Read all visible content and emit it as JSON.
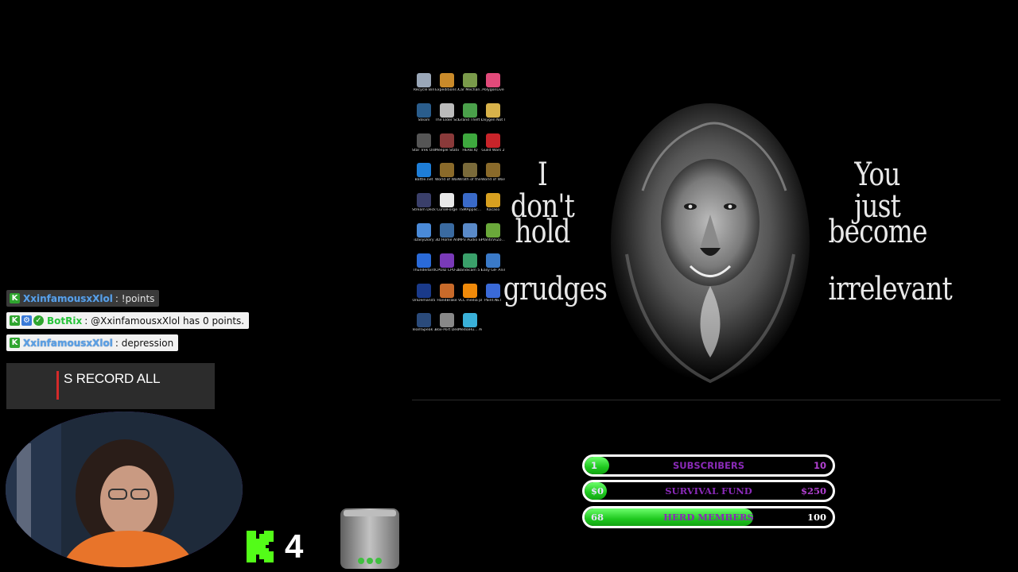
{
  "desktop": {
    "icons": [
      {
        "label": "Recycle Bin",
        "icon": "recycle-bin-icon",
        "color": "#9aa7b8"
      },
      {
        "label": "Expeditions A MudRunner ...",
        "icon": "expeditions-icon",
        "color": "#c98a2a"
      },
      {
        "label": "Car Mechan...",
        "icon": "car-mechanic-icon",
        "color": "#7a9a4a"
      },
      {
        "label": "PolygonLive",
        "icon": "polygonlive-icon",
        "color": "#e24a7a"
      },
      {
        "label": "Steam",
        "icon": "steam-icon",
        "color": "#2a5d8c"
      },
      {
        "label": "The Elder Scrolls ...",
        "icon": "elder-scrolls-icon",
        "color": "#bbbbbb"
      },
      {
        "label": "Grand Theft Auto V",
        "icon": "gta-icon",
        "color": "#4aa04a"
      },
      {
        "label": "Oxygen Not Included",
        "icon": "oxygen-icon",
        "color": "#d8b24a"
      },
      {
        "label": "Star Trek Online",
        "icon": "star-trek-icon",
        "color": "#555555"
      },
      {
        "label": "Meeple Station",
        "icon": "meeple-icon",
        "color": "#8a3a3a"
      },
      {
        "label": "HERB.IQ",
        "icon": "herb-icon",
        "color": "#3ea83e"
      },
      {
        "label": "Guild Wars 2",
        "icon": "guild-wars-icon",
        "color": "#c8242a"
      },
      {
        "label": "Battle.net",
        "icon": "battlenet-icon",
        "color": "#1e7ed8"
      },
      {
        "label": "World of Warcra...",
        "icon": "wow-icon",
        "color": "#8a6a2a"
      },
      {
        "label": "Wrath of the Lich King ...",
        "icon": "wotlk-icon",
        "color": "#7a6a3a"
      },
      {
        "label": "World of Warcraft",
        "icon": "wow-classic-icon",
        "color": "#8a6a2a"
      },
      {
        "label": "Stream Deck",
        "icon": "stream-deck-icon",
        "color": "#3a3f6a"
      },
      {
        "label": "CurseForge",
        "icon": "curseforge-icon",
        "color": "#e8e8e8"
      },
      {
        "label": "TSMApplic...",
        "icon": "tsm-icon",
        "color": "#3a6ac8"
      },
      {
        "label": "Kacaso",
        "icon": "kacaso-icon",
        "color": "#d8a020"
      },
      {
        "label": "iDailyDiary",
        "icon": "diary-icon",
        "color": "#4a8ad8"
      },
      {
        "label": "3D Home Architect ...",
        "icon": "home-architect-icon",
        "color": "#3a6aa0"
      },
      {
        "label": "MP3 Audio Editor",
        "icon": "mp3-editor-icon",
        "color": "#5a8ac8"
      },
      {
        "label": "PlantsVsZo...",
        "icon": "pvz-icon",
        "color": "#6aa83a"
      },
      {
        "label": "Thunderbird",
        "icon": "thunderbird-icon",
        "color": "#2a6ad8"
      },
      {
        "label": "CPUID CPU-Z",
        "icon": "cpuz-icon",
        "color": "#7a3ab8"
      },
      {
        "label": "Bandicam 5 Pro",
        "icon": "bandicam-icon",
        "color": "#3aa06a"
      },
      {
        "label": "Easy GIF Animator",
        "icon": "gif-animator-icon",
        "color": "#3a7ac8"
      },
      {
        "label": "OnDemand5",
        "icon": "ondemand-icon",
        "color": "#1a3a8a"
      },
      {
        "label": "HandBrake",
        "icon": "handbrake-icon",
        "color": "#c86a2a"
      },
      {
        "label": "VLC media player",
        "icon": "vlc-icon",
        "color": "#f08a0a"
      },
      {
        "label": "Paint.NET",
        "icon": "paintnet-icon",
        "color": "#3a6ad8"
      },
      {
        "label": "TeamSpeak 3 Client",
        "icon": "teamspeak-icon",
        "color": "#2a4a7a"
      },
      {
        "label": "Box-Port Design",
        "icon": "boxport-icon",
        "color": "#888888"
      },
      {
        "label": "MediaHu... Audio Con...",
        "icon": "mediahuman-icon",
        "color": "#3ab0d8"
      }
    ],
    "quote_left": [
      "I don't",
      "hold",
      "grudges"
    ],
    "quote_right": [
      "You just",
      "become",
      "irrelevant"
    ]
  },
  "chat": [
    {
      "user": "XxinfamousxXlol",
      "message": ": !points",
      "badges": [
        "kick-badge-icon"
      ],
      "dim": true
    },
    {
      "user": "BotRix",
      "message": ": @XxinfamousxXlol has 0 points.",
      "badges": [
        "kick-badge-icon",
        "bot-badge-icon",
        "verified-badge-icon"
      ],
      "dim": false
    },
    {
      "user": "XxinfamousxXlol",
      "message": ": depression",
      "badges": [
        "kick-badge-icon"
      ],
      "dim": false
    }
  ],
  "alert": {
    "text": "S RECORD ALL",
    "accent": "#d42a2a"
  },
  "kick_counter": {
    "value": "4",
    "icon": "kick-logo-icon",
    "color": "#53fc18"
  },
  "tip_jar": {
    "icon": "tip-jar-icon"
  },
  "goals": [
    {
      "title": "SUBSCRIBERS",
      "start": "1",
      "end": "10",
      "progress": 0.1,
      "title_color": "#8a2ab8",
      "start_color": "#e8e0ff",
      "end_color": "#b040d0"
    },
    {
      "title": "SURVIVAL FUND",
      "start": "$0",
      "end": "$250",
      "progress": 0.08,
      "title_color": "#8a2ab8",
      "start_color": "#e8e0ff",
      "end_color": "#b040d0"
    },
    {
      "title": "HERD MEMBERS",
      "start": "68",
      "end": "100",
      "progress": 0.68,
      "title_color": "#8a2ab8",
      "start_color": "#e8e0ff",
      "end_color": "#ffffff"
    }
  ]
}
